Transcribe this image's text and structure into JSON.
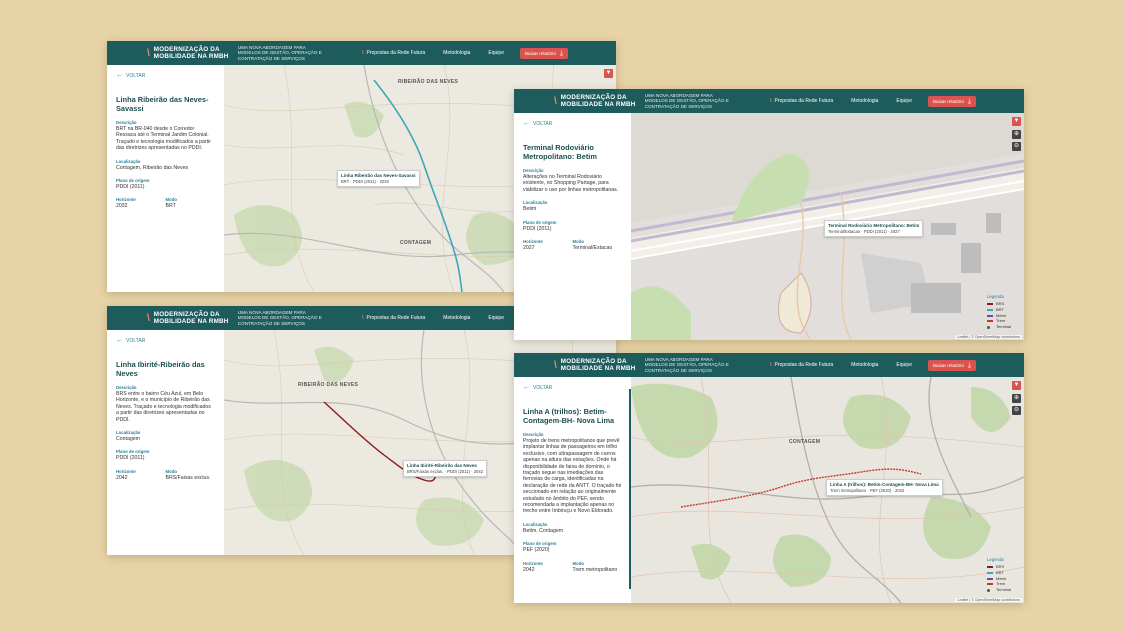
{
  "header": {
    "brand": "MODERNIZAÇÃO DA MOBILIDADE NA RMBH",
    "tagline": "UMA NOVA ABORDAGEM PARA MODELOS DE GESTÃO, OPERAÇÃO E CONTRATAÇÃO DE SERVIÇOS",
    "nav_proposals": "Propostas da Rede Futura",
    "nav_methodology": "Metodologia",
    "nav_team": "Equipe",
    "download_button": "Baixar relatório"
  },
  "common": {
    "back": "VOLTAR",
    "desc_label": "Descrição",
    "loc_label": "Localização",
    "plan_label": "Plano de origem",
    "horizon_label": "Horizonte",
    "mode_label": "Modo",
    "legend_title": "Legenda",
    "legend_items": [
      "BRS",
      "BRT",
      "Metrô",
      "Trem",
      "Terminal"
    ],
    "attribution": "Leaflet | © OpenStreetMap contributors"
  },
  "colors": {
    "header": "#1d5b5c",
    "accent": "#d9534f",
    "brt": "#3aa8b8",
    "brs": "#8b1a1a",
    "train": "#c0392b"
  },
  "screens": [
    {
      "title": "Linha Ribeirão das Neves-Savassi",
      "description": "BRT na BR-040 desde o Corredor Ressaca até o Terminal Jardim Colonial. Traçado e tecnologia modificados a partir das diretrizes apresentadas no PDDI.",
      "location": "Contagem, Ribeirão das Neves",
      "plan": "PDDI (2011)",
      "horizon": "2032",
      "mode": "BRT",
      "popup_title": "Linha Ribeirão das Neves-Savassi",
      "popup_sub": "BRT · PDDI (2011) · 2032",
      "map_labels": [
        "Ribeirão das Neves",
        "Contagem"
      ]
    },
    {
      "title": "Linha Ibirité-Ribeirão das Neves",
      "description": "BRS entre o bairro Céu Azul, em Belo Horizonte, e o município de Ribeirão das Neves. Traçado e tecnologia modificados a partir das diretrizes apresentadas no PDDI.",
      "location": "Contagem",
      "plan": "PDDI (2011)",
      "horizon": "2042",
      "mode": "BRS/Faixas exclus.",
      "popup_title": "Linha Ibirité-Ribeirão das Neves",
      "popup_sub": "BRS/Faixas exclus. · PDDI (2011) · 2042",
      "map_labels": [
        "Ribeirão das Neves"
      ]
    },
    {
      "title": "Terminal Rodoviário Metropolitano: Betim",
      "description": "Alterações no Terminal Rodoviário existente, no Shopping Partage, para viabilizar o uso por linhas metropolitanas.",
      "location": "Betim",
      "plan": "PDDI (2011)",
      "horizon": "2027",
      "mode": "Terminal/Estacao",
      "popup_title": "Terminal Rodoviário Metropolitano: Betim",
      "popup_sub": "Terminal/Estacao · PDDI (2011) · 2027"
    },
    {
      "title": "Linha A (trilhos): Betim-Contagem-BH- Nova Lima",
      "description": "Projeto de trens metropolitanos que prevê implantar linhas de passageiros em trilho exclusivo, com ultrapassagem de carros apenas na altura das estações. Onde há disponibilidade de faixa de domínio, o traçado segue nas imediações das ferrovias de carga, identificadas na declaração de rede da ANTT. O traçado foi seccionado em relação ao originalmente estudado no âmbito do PEF, sendo recomendada a implantação apenas no trecho entre Imbiruçu e Novo Eldorado.",
      "location": "Betim, Contagem",
      "plan": "PEF (2020)",
      "horizon": "2042",
      "mode": "Trem metropolitano",
      "popup_title": "Linha A (trilhos): Betim-Contagem-BH- Nova Lima",
      "popup_sub": "Trem metropolitano · PEF (2020) · 2042",
      "map_labels": [
        "Contagem"
      ]
    }
  ]
}
